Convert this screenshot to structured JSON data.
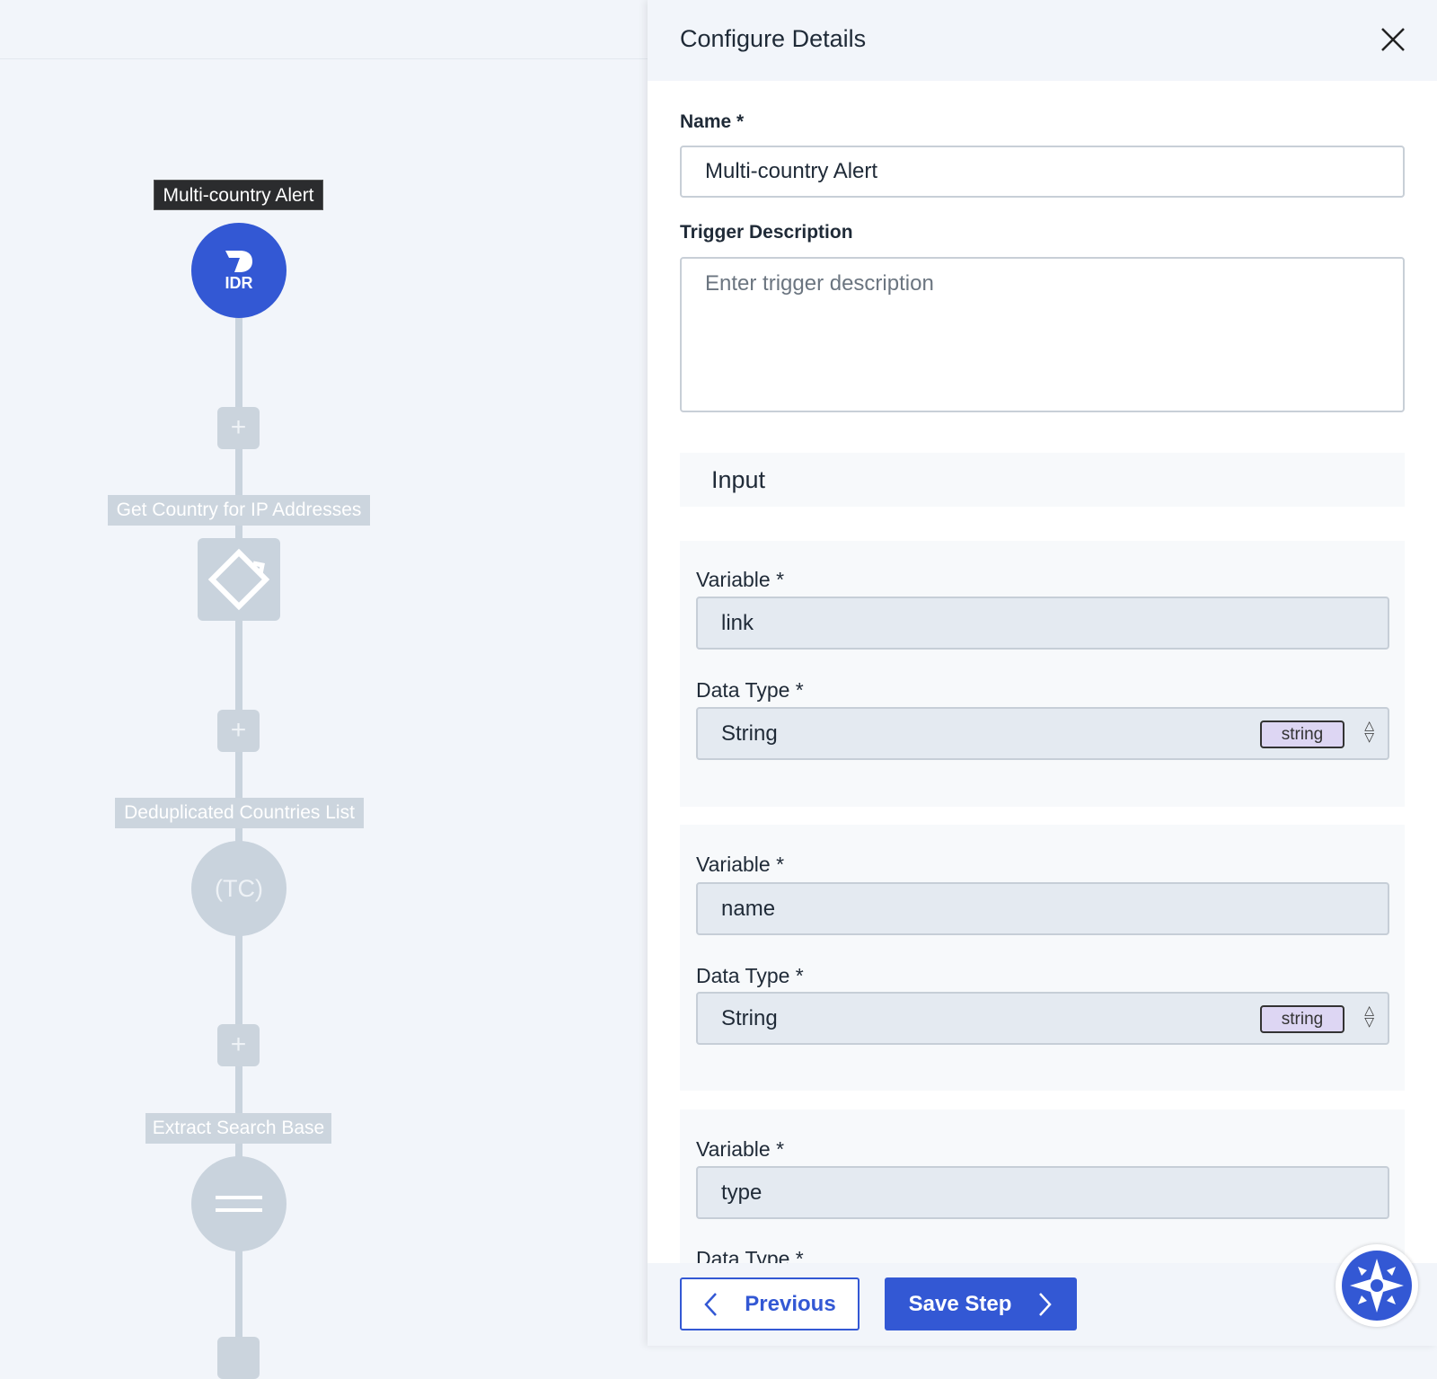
{
  "canvas": {
    "trigger_label": "Multi-country Alert",
    "trigger_icon_text": "IDR",
    "steps": [
      {
        "label": "Get Country for IP Addresses",
        "icon": "diamond-arrow-icon"
      },
      {
        "label": "Deduplicated Countries List",
        "icon_text": "(TC)"
      },
      {
        "label": "Extract Search Base",
        "icon": "equals-icon"
      }
    ]
  },
  "panel": {
    "title": "Configure Details",
    "name_label": "Name *",
    "name_value": "Multi-country Alert",
    "desc_label": "Trigger Description",
    "desc_placeholder": "Enter trigger description",
    "section_title": "Input",
    "inputs": [
      {
        "var_label": "Variable *",
        "var_value": "link",
        "type_label": "Data Type *",
        "type_value": "String",
        "badge": "string"
      },
      {
        "var_label": "Variable *",
        "var_value": "name",
        "type_label": "Data Type *",
        "type_value": "String",
        "badge": "string"
      },
      {
        "var_label": "Variable *",
        "var_value": "type",
        "type_label": "Data Type *"
      }
    ],
    "previous_label": "Previous",
    "save_label": "Save Step"
  },
  "colors": {
    "accent": "#3358d4",
    "badge": "#ddd6f3",
    "inactive_node": "#c9d3dd"
  }
}
